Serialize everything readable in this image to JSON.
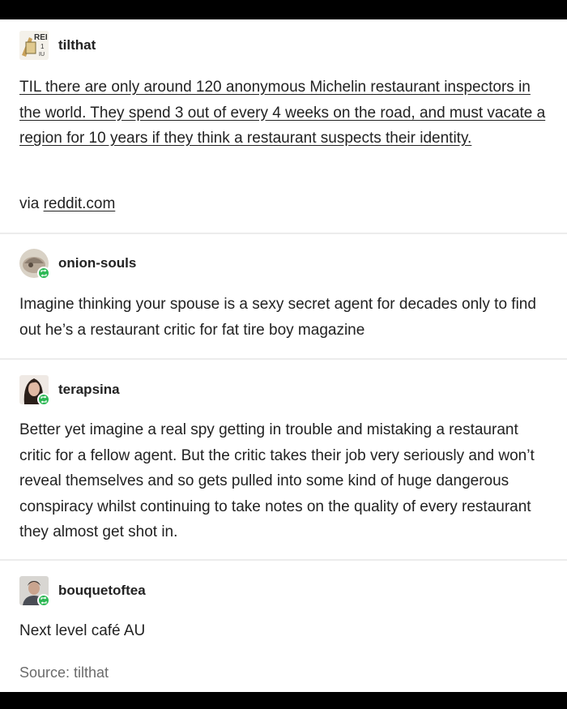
{
  "posts": [
    {
      "username": "tilthat",
      "avatar": "reddit-til-avatar",
      "link_text": "TIL there are only around 120 anonymous Michelin restaurant inspectors in the world. They spend 3 out of every 4 weeks on the road, and must vacate a region for 10 years if they think a restaurant suspects their identity.",
      "via_prefix": "via ",
      "via_link": "reddit.com"
    },
    {
      "username": "onion-souls",
      "avatar": "onion-avatar",
      "reblog_icon": "reblog-icon",
      "text": "Imagine thinking your spouse is a sexy secret agent for decades only to find out he’s a restaurant critic for fat tire boy magazine"
    },
    {
      "username": "terapsina",
      "avatar": "portrait-avatar",
      "reblog_icon": "reblog-icon",
      "text": "Better yet imagine a real spy getting in trouble and mistaking a restaurant critic for a fellow agent. But the critic takes their job very seriously and won’t reveal themselves and so gets pulled into some kind of huge dangerous conspiracy whilst continuing to take notes on the quality of every restaurant they almost get shot in."
    },
    {
      "username": "bouquetoftea",
      "avatar": "person-avatar",
      "reblog_icon": "reblog-icon",
      "text": "Next level café AU",
      "source": "Source: tilthat"
    }
  ],
  "colors": {
    "reblog_badge": "#2cb854",
    "source_text": "#6b6b6b",
    "divider": "#ececec"
  }
}
